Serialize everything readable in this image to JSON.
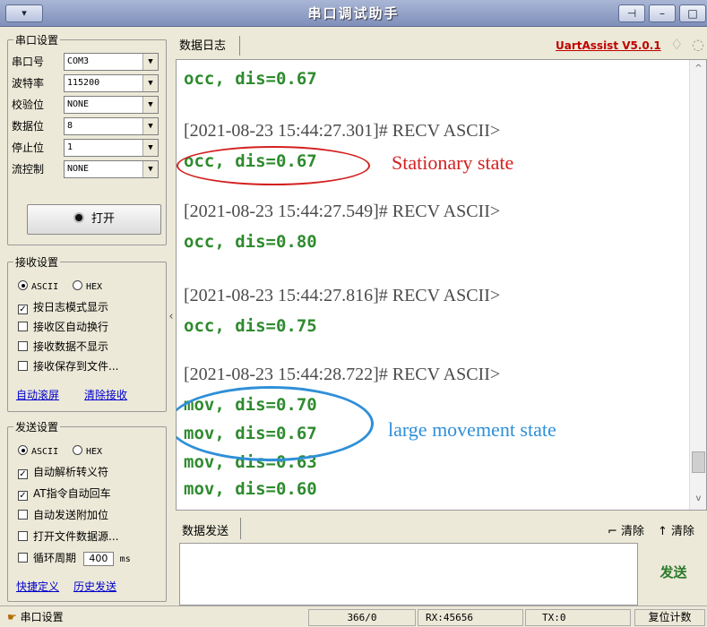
{
  "window": {
    "title": "串口调试助手",
    "menu_label": "▾",
    "pin_label": "⊣",
    "min_label": "–",
    "max_label": "□"
  },
  "serial": {
    "group_title": "串口设置",
    "fields": [
      {
        "label": "串口号",
        "value": "COM3"
      },
      {
        "label": "波特率",
        "value": "115200"
      },
      {
        "label": "校验位",
        "value": "NONE"
      },
      {
        "label": "数据位",
        "value": "8"
      },
      {
        "label": "停止位",
        "value": "1"
      },
      {
        "label": "流控制",
        "value": "NONE"
      }
    ],
    "open_button": "打开",
    "open_icon": "record-icon"
  },
  "receive": {
    "group_title": "接收设置",
    "mode_ascii": "ASCII",
    "mode_hex": "HEX",
    "options": [
      {
        "label": "按日志模式显示",
        "checked": true
      },
      {
        "label": "接收区自动换行",
        "checked": false
      },
      {
        "label": "接收数据不显示",
        "checked": false
      },
      {
        "label": "接收保存到文件...",
        "checked": false
      }
    ],
    "link_autoscroll": "自动滚屏",
    "link_clear": "清除接收"
  },
  "send_settings": {
    "group_title": "发送设置",
    "mode_ascii": "ASCII",
    "mode_hex": "HEX",
    "options": [
      {
        "label": "自动解析转义符",
        "checked": true
      },
      {
        "label": "AT指令自动回车",
        "checked": true
      },
      {
        "label": "自动发送附加位",
        "checked": false
      },
      {
        "label": "打开文件数据源...",
        "checked": false
      },
      {
        "label": "循环周期",
        "checked": false
      }
    ],
    "cycle_value": "400",
    "cycle_unit": "ms",
    "link_shortcut": "快捷定义",
    "link_history": "历史发送"
  },
  "log": {
    "tab_label": "数据日志",
    "version_link": "UartAssist V5.0.1",
    "lines": [
      {
        "type": "data",
        "text": "occ, dis=0.67"
      },
      {
        "type": "header",
        "text": "[2021-08-23 15:44:27.301]# RECV ASCII>"
      },
      {
        "type": "data",
        "text": "occ, dis=0.67"
      },
      {
        "type": "header",
        "text": "[2021-08-23 15:44:27.549]# RECV ASCII>"
      },
      {
        "type": "data",
        "text": "occ, dis=0.80"
      },
      {
        "type": "header",
        "text": "[2021-08-23 15:44:27.816]# RECV ASCII>"
      },
      {
        "type": "data",
        "text": "occ, dis=0.75"
      },
      {
        "type": "header",
        "text": "[2021-08-23 15:44:28.722]# RECV ASCII>"
      },
      {
        "type": "data",
        "text": "mov, dis=0.70"
      },
      {
        "type": "data",
        "text": "mov, dis=0.67"
      },
      {
        "type": "data",
        "text": "mov, dis=0.63"
      },
      {
        "type": "data",
        "text": "mov, dis=0.60"
      }
    ]
  },
  "annotations": {
    "stationary": {
      "text": "Stationary state",
      "color": "#d42020"
    },
    "movement": {
      "text": "large movement state",
      "color": "#2f8fd8"
    }
  },
  "send": {
    "tab_label": "数据发送",
    "clear1": "清除",
    "clear2": "清除",
    "send_button": "发送"
  },
  "status": {
    "label": "串口设置",
    "count": "366/0",
    "rx": "RX:45656",
    "tx": "TX:0",
    "reset": "复位计数"
  },
  "colors": {
    "log_data": "#2e8b2e",
    "log_header": "#4a4a4a",
    "version": "#c00000",
    "send": "#2a7a2a"
  }
}
